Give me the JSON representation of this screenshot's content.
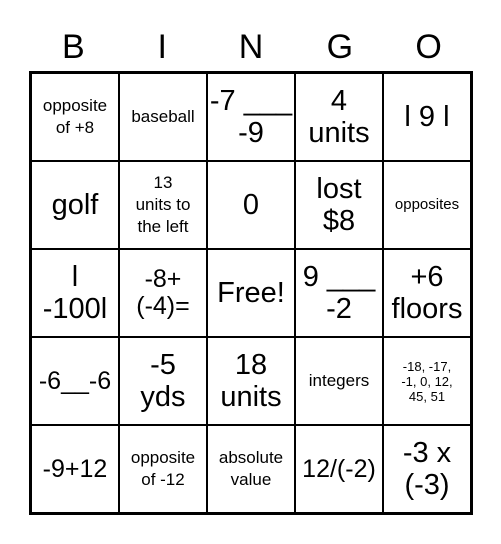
{
  "header": [
    "B",
    "I",
    "N",
    "G",
    "O"
  ],
  "cells": [
    {
      "text": "opposite\nof +8",
      "size": "md"
    },
    {
      "text": "baseball",
      "size": "md"
    },
    {
      "text": "-7 ___\n-9",
      "size": "xl"
    },
    {
      "text": "4\nunits",
      "size": "xl"
    },
    {
      "text": "l 9 l",
      "size": "xl"
    },
    {
      "text": "golf",
      "size": "xl"
    },
    {
      "text": "13\nunits to\nthe left",
      "size": "md"
    },
    {
      "text": "0",
      "size": "xl"
    },
    {
      "text": "lost\n$8",
      "size": "xl"
    },
    {
      "text": "opposites",
      "size": "sm"
    },
    {
      "text": "l\n-100l",
      "size": "xl"
    },
    {
      "text": "-8+\n(-4)=",
      "size": "lg"
    },
    {
      "text": "Free!",
      "size": "xl"
    },
    {
      "text": "9 ___\n-2",
      "size": "xl"
    },
    {
      "text": "+6\nfloors",
      "size": "xl"
    },
    {
      "text": "-6__-6",
      "size": "lg"
    },
    {
      "text": "-5\nyds",
      "size": "xl"
    },
    {
      "text": "18\nunits",
      "size": "xl"
    },
    {
      "text": "integers",
      "size": "md"
    },
    {
      "text": "-18, -17,\n-1, 0, 12,\n45, 51",
      "size": "xs"
    },
    {
      "text": "-9+12",
      "size": "lg"
    },
    {
      "text": "opposite\nof -12",
      "size": "md"
    },
    {
      "text": "absolute\nvalue",
      "size": "md"
    },
    {
      "text": "12/(-2)",
      "size": "lg"
    },
    {
      "text": "-3 x\n(-3)",
      "size": "xl"
    }
  ]
}
